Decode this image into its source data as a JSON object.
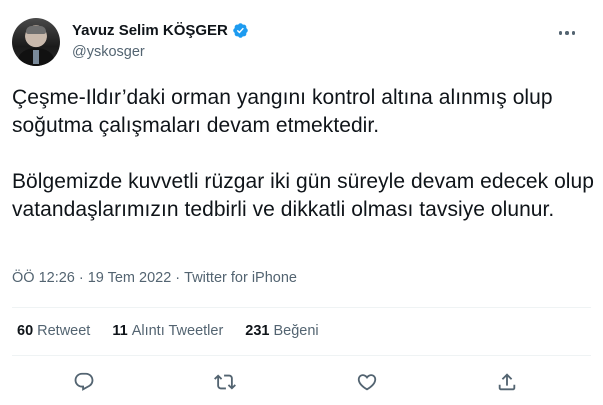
{
  "author": {
    "name": "Yavuz Selim KÖŞGER",
    "handle": "@yskosger",
    "verified": true,
    "verified_color": "#1d9bf0"
  },
  "tweet": {
    "paragraphs": [
      "Çeşme-Ildır’daki  orman yangını kontrol altına alınmış olup soğutma çalışmaları devam etmektedir.",
      "Bölgemizde kuvvetli rüzgar iki gün süreyle devam edecek olup vatandaşlarımızın tedbirli ve dikkatli olması tavsiye olunur."
    ]
  },
  "meta": {
    "time": "ÖÖ 12:26",
    "separator1": "·",
    "date": "19 Tem 2022",
    "separator2": "·",
    "source": "Twitter for iPhone"
  },
  "stats": {
    "retweets_count": "60",
    "retweets_label": "Retweet",
    "quotes_count": "11",
    "quotes_label": "Alıntı Tweetler",
    "likes_count": "231",
    "likes_label": "Beğeni"
  },
  "actions": {
    "reply_icon": "reply-icon",
    "retweet_icon": "retweet-icon",
    "like_icon": "heart-icon",
    "share_icon": "share-icon"
  },
  "colors": {
    "text": "#0f1419",
    "muted": "#536471",
    "divider": "#eff3f4"
  }
}
